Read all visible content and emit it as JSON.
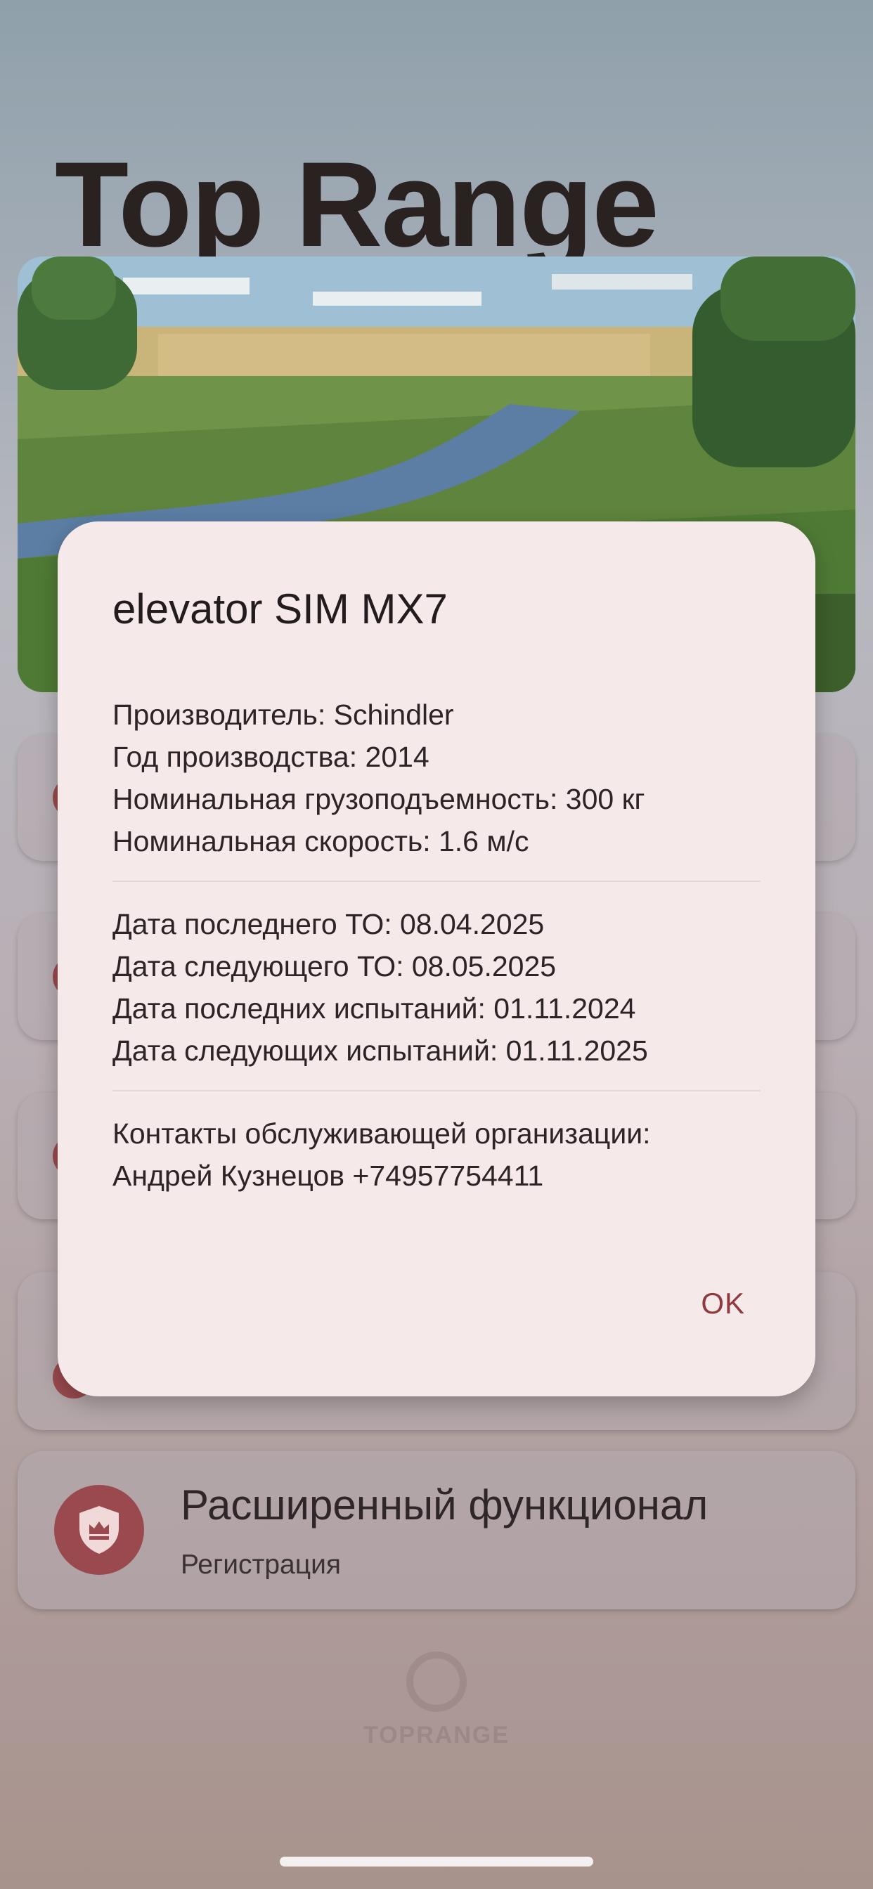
{
  "app": {
    "title": "Top Range",
    "footer_logo_text": "TOPRANGE"
  },
  "menu": {
    "items": [
      {
        "title": "",
        "subtitle": ""
      },
      {
        "title": "",
        "subtitle": ""
      },
      {
        "title": "",
        "subtitle": ""
      },
      {
        "title": "",
        "subtitle": ""
      },
      {
        "title": "Расширенный функционал",
        "subtitle": "Регистрация",
        "icon": "crown-shield-icon"
      }
    ]
  },
  "dialog": {
    "title": "elevator SIM MX7",
    "equipment": [
      "Производитель: Schindler",
      "Год производства: 2014",
      "Номинальная грузоподъемность: 300 кг",
      "Номинальная скорость: 1.6 м/с"
    ],
    "dates": [
      "Дата последнего ТО: 08.04.2025",
      "Дата следующего ТО: 08.05.2025",
      "Дата последних испытаний: 01.11.2024",
      "Дата следующих испытаний: 01.11.2025"
    ],
    "contacts": [
      "Контакты обслуживающей организации:",
      "Андрей Кузнецов +74957754411"
    ],
    "ok_label": "OK"
  },
  "colors": {
    "accent": "#9a4a4e",
    "dialog_bg": "#f5e9ea",
    "ok_text": "#8e3a3e"
  }
}
